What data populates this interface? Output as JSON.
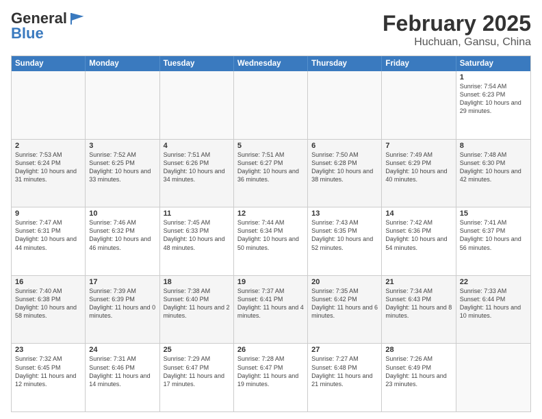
{
  "logo": {
    "general": "General",
    "blue": "Blue"
  },
  "title": "February 2025",
  "subtitle": "Huchuan, Gansu, China",
  "weekdays": [
    "Sunday",
    "Monday",
    "Tuesday",
    "Wednesday",
    "Thursday",
    "Friday",
    "Saturday"
  ],
  "rows": [
    [
      {
        "day": "",
        "info": ""
      },
      {
        "day": "",
        "info": ""
      },
      {
        "day": "",
        "info": ""
      },
      {
        "day": "",
        "info": ""
      },
      {
        "day": "",
        "info": ""
      },
      {
        "day": "",
        "info": ""
      },
      {
        "day": "1",
        "info": "Sunrise: 7:54 AM\nSunset: 6:23 PM\nDaylight: 10 hours and 29 minutes."
      }
    ],
    [
      {
        "day": "2",
        "info": "Sunrise: 7:53 AM\nSunset: 6:24 PM\nDaylight: 10 hours and 31 minutes."
      },
      {
        "day": "3",
        "info": "Sunrise: 7:52 AM\nSunset: 6:25 PM\nDaylight: 10 hours and 33 minutes."
      },
      {
        "day": "4",
        "info": "Sunrise: 7:51 AM\nSunset: 6:26 PM\nDaylight: 10 hours and 34 minutes."
      },
      {
        "day": "5",
        "info": "Sunrise: 7:51 AM\nSunset: 6:27 PM\nDaylight: 10 hours and 36 minutes."
      },
      {
        "day": "6",
        "info": "Sunrise: 7:50 AM\nSunset: 6:28 PM\nDaylight: 10 hours and 38 minutes."
      },
      {
        "day": "7",
        "info": "Sunrise: 7:49 AM\nSunset: 6:29 PM\nDaylight: 10 hours and 40 minutes."
      },
      {
        "day": "8",
        "info": "Sunrise: 7:48 AM\nSunset: 6:30 PM\nDaylight: 10 hours and 42 minutes."
      }
    ],
    [
      {
        "day": "9",
        "info": "Sunrise: 7:47 AM\nSunset: 6:31 PM\nDaylight: 10 hours and 44 minutes."
      },
      {
        "day": "10",
        "info": "Sunrise: 7:46 AM\nSunset: 6:32 PM\nDaylight: 10 hours and 46 minutes."
      },
      {
        "day": "11",
        "info": "Sunrise: 7:45 AM\nSunset: 6:33 PM\nDaylight: 10 hours and 48 minutes."
      },
      {
        "day": "12",
        "info": "Sunrise: 7:44 AM\nSunset: 6:34 PM\nDaylight: 10 hours and 50 minutes."
      },
      {
        "day": "13",
        "info": "Sunrise: 7:43 AM\nSunset: 6:35 PM\nDaylight: 10 hours and 52 minutes."
      },
      {
        "day": "14",
        "info": "Sunrise: 7:42 AM\nSunset: 6:36 PM\nDaylight: 10 hours and 54 minutes."
      },
      {
        "day": "15",
        "info": "Sunrise: 7:41 AM\nSunset: 6:37 PM\nDaylight: 10 hours and 56 minutes."
      }
    ],
    [
      {
        "day": "16",
        "info": "Sunrise: 7:40 AM\nSunset: 6:38 PM\nDaylight: 10 hours and 58 minutes."
      },
      {
        "day": "17",
        "info": "Sunrise: 7:39 AM\nSunset: 6:39 PM\nDaylight: 11 hours and 0 minutes."
      },
      {
        "day": "18",
        "info": "Sunrise: 7:38 AM\nSunset: 6:40 PM\nDaylight: 11 hours and 2 minutes."
      },
      {
        "day": "19",
        "info": "Sunrise: 7:37 AM\nSunset: 6:41 PM\nDaylight: 11 hours and 4 minutes."
      },
      {
        "day": "20",
        "info": "Sunrise: 7:35 AM\nSunset: 6:42 PM\nDaylight: 11 hours and 6 minutes."
      },
      {
        "day": "21",
        "info": "Sunrise: 7:34 AM\nSunset: 6:43 PM\nDaylight: 11 hours and 8 minutes."
      },
      {
        "day": "22",
        "info": "Sunrise: 7:33 AM\nSunset: 6:44 PM\nDaylight: 11 hours and 10 minutes."
      }
    ],
    [
      {
        "day": "23",
        "info": "Sunrise: 7:32 AM\nSunset: 6:45 PM\nDaylight: 11 hours and 12 minutes."
      },
      {
        "day": "24",
        "info": "Sunrise: 7:31 AM\nSunset: 6:46 PM\nDaylight: 11 hours and 14 minutes."
      },
      {
        "day": "25",
        "info": "Sunrise: 7:29 AM\nSunset: 6:47 PM\nDaylight: 11 hours and 17 minutes."
      },
      {
        "day": "26",
        "info": "Sunrise: 7:28 AM\nSunset: 6:47 PM\nDaylight: 11 hours and 19 minutes."
      },
      {
        "day": "27",
        "info": "Sunrise: 7:27 AM\nSunset: 6:48 PM\nDaylight: 11 hours and 21 minutes."
      },
      {
        "day": "28",
        "info": "Sunrise: 7:26 AM\nSunset: 6:49 PM\nDaylight: 11 hours and 23 minutes."
      },
      {
        "day": "",
        "info": ""
      }
    ]
  ]
}
